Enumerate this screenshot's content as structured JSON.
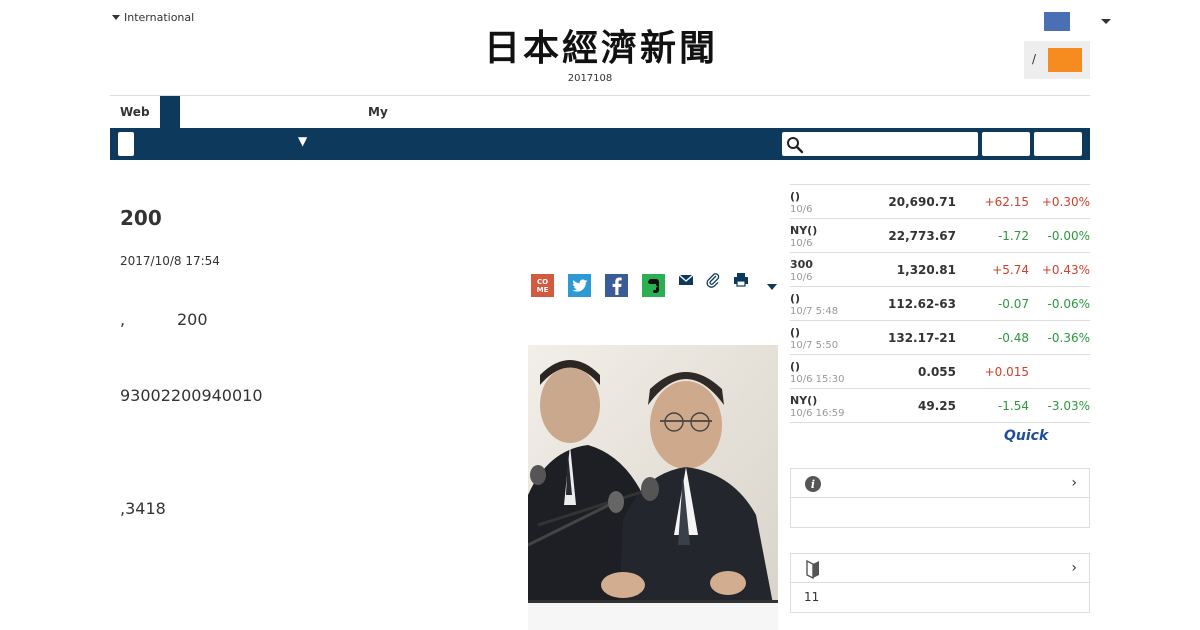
{
  "header": {
    "international_label": "International",
    "logo_text": "日本經濟新聞",
    "edition_date": "2017108",
    "login_separator": "/"
  },
  "tabs": {
    "web_label": "Web",
    "my_label": "My"
  },
  "nav": {
    "dropdown_glyph": "▼",
    "search_placeholder": ""
  },
  "article": {
    "headline": "200",
    "date": "2017/10/8 17:54",
    "p1_lead": ",",
    "p1_text": "200",
    "p2_text": "93002200940010",
    "p3_text": ",3418"
  },
  "share": {
    "come_label": "CO\nME",
    "icons": [
      "come-icon",
      "twitter-icon",
      "facebook-icon",
      "evernote-icon",
      "mail-icon",
      "clip-icon",
      "print-icon",
      "more-caret-icon"
    ]
  },
  "market": {
    "rows": [
      {
        "name": "()",
        "when": "10/6",
        "value": "20,690.71",
        "change": "+62.15",
        "pct": "+0.30%",
        "dir": "up"
      },
      {
        "name": "NY()",
        "when": "10/6",
        "value": "22,773.67",
        "change": "-1.72",
        "pct": "-0.00%",
        "dir": "down"
      },
      {
        "name": "300",
        "when": "10/6",
        "value": "1,320.81",
        "change": "+5.74",
        "pct": "+0.43%",
        "dir": "up"
      },
      {
        "name": "()",
        "when": "10/7 5:48",
        "value": "112.62-63",
        "change": "-0.07",
        "pct": "-0.06%",
        "dir": "down"
      },
      {
        "name": "()",
        "when": "10/7 5:50",
        "value": "132.17-21",
        "change": "-0.48",
        "pct": "-0.36%",
        "dir": "down"
      },
      {
        "name": "()",
        "when": "10/6 15:30",
        "value": "0.055",
        "change": "+0.015",
        "pct": "",
        "dir": "up"
      },
      {
        "name": "NY()",
        "when": "10/6 16:59",
        "value": "49.25",
        "change": "-1.54",
        "pct": "-3.03%",
        "dir": "down"
      }
    ],
    "provider": "Quick"
  },
  "boxes": {
    "info_chevron": "›",
    "beginner_chevron": "›",
    "beginner_text": "11"
  },
  "colors": {
    "nav_bg": "#0d3a5c",
    "up": "#d1402a",
    "down": "#2a9a3c",
    "orange": "#f68b1f"
  }
}
